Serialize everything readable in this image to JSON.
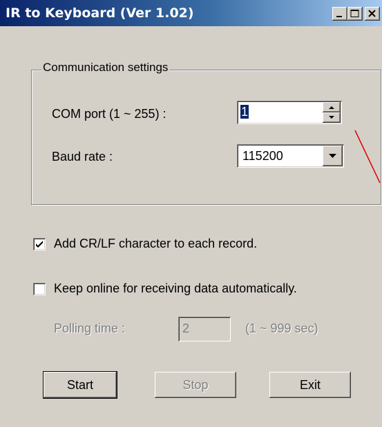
{
  "window": {
    "title": "IR to Keyboard (Ver 1.02)",
    "controls": [
      "minimize-icon",
      "maximize-icon",
      "close-icon"
    ]
  },
  "group": {
    "label": "Communication settings"
  },
  "com_port": {
    "label": "COM port (1 ~ 255) :",
    "value": "1"
  },
  "baud_rate": {
    "label": "Baud rate :",
    "value": "115200"
  },
  "options": {
    "add_crlf": {
      "label": "Add CR/LF character to each record.",
      "checked": true
    },
    "keep_online": {
      "label": "Keep online for receiving data automatically.",
      "checked": false
    }
  },
  "polling": {
    "label": "Polling time :",
    "value": "2",
    "range": "(1 ~ 999 sec)"
  },
  "buttons": {
    "start": "Start",
    "stop": "Stop",
    "exit": "Exit"
  },
  "colors": {
    "titlebar_start": "#0a246a",
    "titlebar_end": "#a6caf0",
    "face": "#d4d0c8",
    "annotation_line": "#e00000"
  }
}
